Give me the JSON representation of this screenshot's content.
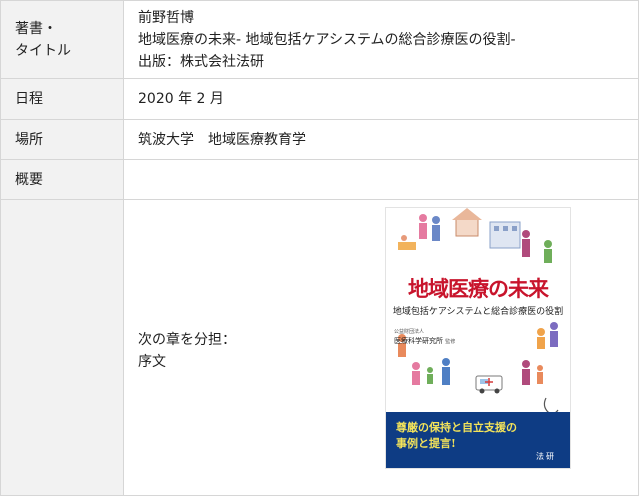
{
  "rows": [
    {
      "label": "著書・\nタイトル",
      "value": "前野哲博\n地域医療の未来- 地域包括ケアシステムの総合診療医の役割-\n出版：株式会社法研"
    },
    {
      "label": "日程",
      "value": "2020 年 2 月"
    },
    {
      "label": "場所",
      "value": "筑波大学　地域医療教育学"
    },
    {
      "label": "概要",
      "value": ""
    },
    {
      "label": "",
      "value": "次の章を分担：\n序文"
    }
  ],
  "cover": {
    "title": "地域医療の未来",
    "subtitle": "地域包括ケアシステムと総合診療医の役割",
    "publisher_small": "公益財団法人",
    "publisher": "医療科学研究所",
    "publisher_note": "監修",
    "slogan": "尊厳の保持と自立支援の\n事例と提言!",
    "brand": "法研",
    "colors": {
      "title": "#c8142c",
      "band": "#0e3c84",
      "slogan": "#f3e35a"
    }
  }
}
